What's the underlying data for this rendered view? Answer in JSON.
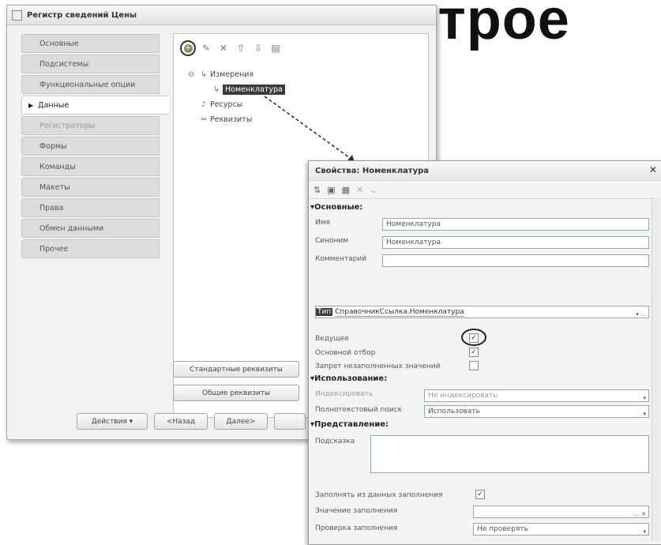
{
  "background_heading": "встрое",
  "register_window": {
    "title": "Регистр сведений Цены",
    "nav": [
      {
        "label": "Основные",
        "state": "normal"
      },
      {
        "label": "Подсистемы",
        "state": "normal"
      },
      {
        "label": "Функциональные опции",
        "state": "normal"
      },
      {
        "label": "Данные",
        "state": "active"
      },
      {
        "label": "Регистраторы",
        "state": "disabled"
      },
      {
        "label": "Формы",
        "state": "normal"
      },
      {
        "label": "Команды",
        "state": "normal"
      },
      {
        "label": "Макеты",
        "state": "normal"
      },
      {
        "label": "Права",
        "state": "normal"
      },
      {
        "label": "Обмен данными",
        "state": "normal"
      },
      {
        "label": "Прочее",
        "state": "normal"
      }
    ],
    "tree": {
      "dimensions": "Измерения",
      "nomenclature": "Номенклатура",
      "resources": "Ресурсы",
      "attributes": "Реквизиты"
    },
    "standard_attributes_button": "Стандартные реквизиты",
    "common_attributes_button": "Общие реквизиты",
    "actions_button": "Действия",
    "back_button": "<Назад",
    "next_button": "Далее>"
  },
  "properties_window": {
    "title": "Свойства: Номенклатура",
    "section_main": "Основные:",
    "name_label": "Имя",
    "name_value": "Номенклатура",
    "synonym_label": "Синоним",
    "synonym_value": "Номенклатура",
    "comment_label": "Комментарий",
    "comment_value": "",
    "type_label": "Тип",
    "type_value": "СправочникСсылка.Номенклатура",
    "leading_label": "Ведущее",
    "main_filter_label": "Основной отбор",
    "deny_empty_label": "Запрет незаполненных значений",
    "section_usage": "Использование:",
    "index_label": "Индексировать",
    "index_value": "Не индексировать",
    "fulltext_label": "Полнотекстовый поиск",
    "fulltext_value": "Использовать",
    "section_view": "Представление:",
    "tooltip_label": "Подсказка",
    "tooltip_value": "",
    "fill_from_label": "Заполнять из данных заполнения",
    "fill_value_label": "Значение заполнения",
    "fill_value": "",
    "fill_check_label": "Проверка заполнения",
    "fill_check_value": "Не проверять",
    "checkboxes": {
      "leading": true,
      "main_filter": true,
      "deny_empty": false,
      "fill_from": true
    }
  }
}
